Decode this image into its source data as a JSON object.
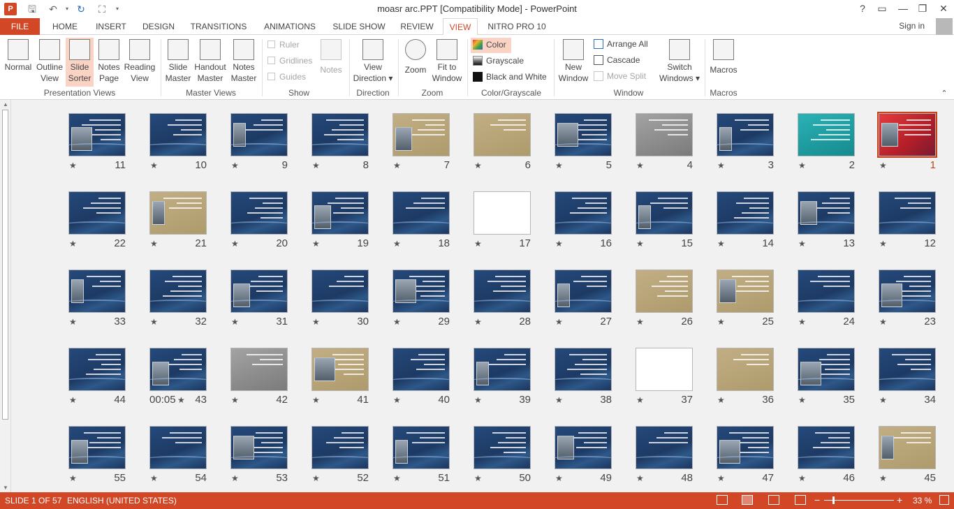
{
  "titlebar": {
    "title": "moasr arc.PPT [Compatibility Mode] - PowerPoint",
    "app_icon": "P",
    "buttons": {
      "help": "?",
      "ribbon_display": "▭",
      "minimize": "—",
      "restore": "❐",
      "close": "✕"
    }
  },
  "tabs": {
    "file": "FILE",
    "items": [
      "HOME",
      "INSERT",
      "DESIGN",
      "TRANSITIONS",
      "ANIMATIONS",
      "SLIDE SHOW",
      "REVIEW",
      "VIEW",
      "NITRO PRO 10"
    ],
    "active": "VIEW",
    "signin": "Sign in"
  },
  "ribbon": {
    "presentation_views": {
      "label": "Presentation Views",
      "buttons": [
        "Normal",
        "Outline\nView",
        "Slide\nSorter",
        "Notes\nPage",
        "Reading\nView"
      ],
      "selected": "Slide Sorter"
    },
    "master_views": {
      "label": "Master Views",
      "buttons": [
        "Slide\nMaster",
        "Handout\nMaster",
        "Notes\nMaster"
      ]
    },
    "show": {
      "label": "Show",
      "checks": [
        "Ruler",
        "Gridlines",
        "Guides"
      ],
      "notes_button": "Notes"
    },
    "direction": {
      "label": "Direction",
      "button": "View\nDirection ▾"
    },
    "zoom": {
      "label": "Zoom",
      "buttons": [
        "Zoom",
        "Fit to\nWindow"
      ]
    },
    "color": {
      "label": "Color/Grayscale",
      "items": [
        "Color",
        "Grayscale",
        "Black and White"
      ],
      "selected": "Color"
    },
    "window": {
      "label": "Window",
      "new_window": "New\nWindow",
      "items": [
        "Arrange All",
        "Cascade",
        "Move Split"
      ],
      "switch": "Switch\nWindows ▾"
    },
    "macros": {
      "label": "Macros",
      "button": "Macros"
    }
  },
  "slides": {
    "selected": 1,
    "rows": [
      [
        1,
        2,
        3,
        4,
        5,
        6,
        7,
        8,
        9,
        10,
        11
      ],
      [
        12,
        13,
        14,
        15,
        16,
        17,
        18,
        19,
        20,
        21,
        22
      ],
      [
        23,
        24,
        25,
        26,
        27,
        28,
        29,
        30,
        31,
        32,
        33
      ],
      [
        34,
        35,
        36,
        37,
        38,
        39,
        40,
        41,
        42,
        43,
        44
      ],
      [
        45,
        46,
        47,
        48,
        49,
        50,
        51,
        52,
        53,
        54,
        55
      ]
    ],
    "themes": {
      "1": "redsel",
      "2": "teal",
      "4": "gray",
      "6": "beige",
      "7": "beige",
      "17": "white",
      "21": "beige",
      "25": "beige",
      "26": "beige",
      "36": "beige",
      "37": "white",
      "41": "beige",
      "42": "gray",
      "45": "beige"
    },
    "timing_label": {
      "slide": 43,
      "text": "00:05"
    },
    "transition_mark": "★"
  },
  "status": {
    "slide_info": "SLIDE 1 OF 57",
    "language": "ENGLISH (UNITED STATES)",
    "zoom_percent": "33 %",
    "zoom_level": 0.33
  }
}
